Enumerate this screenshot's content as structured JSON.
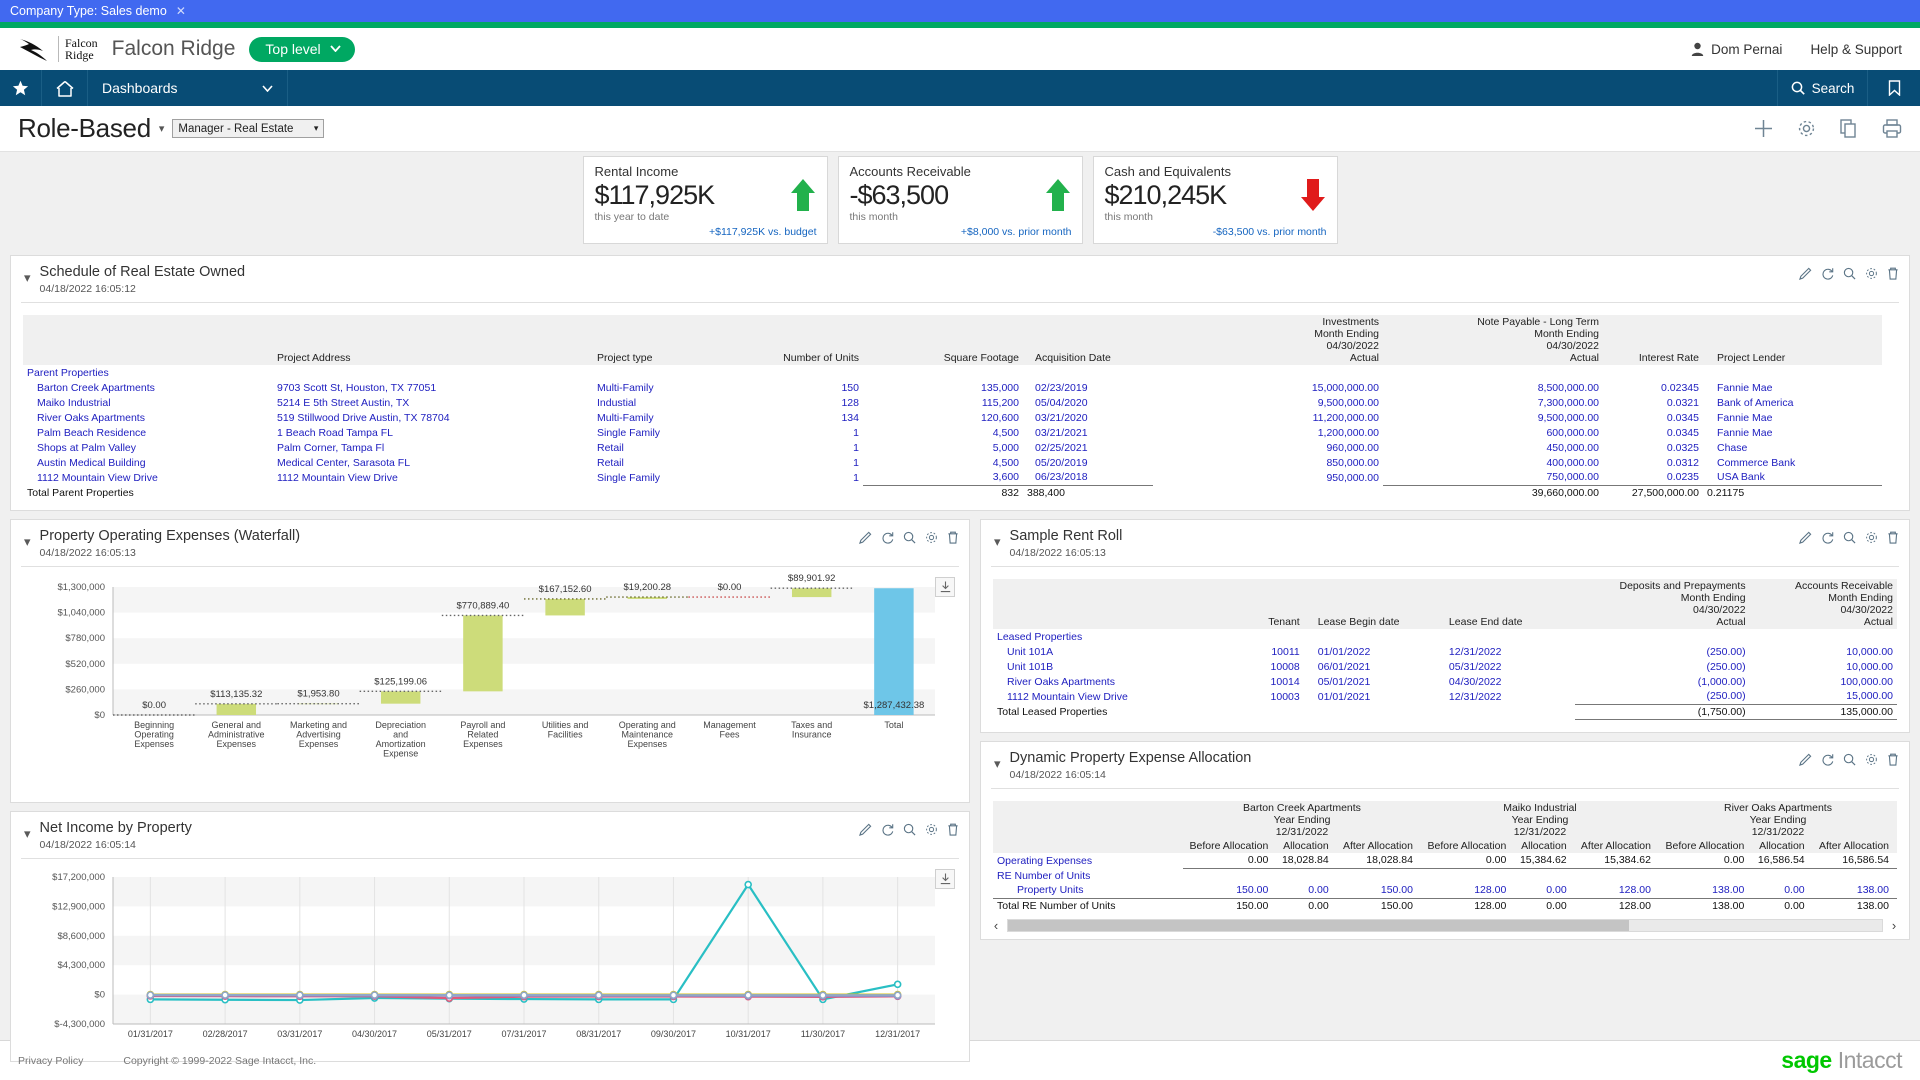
{
  "company_bar": {
    "label": "Company Type: Sales demo",
    "close": "✕"
  },
  "brand": {
    "logo_line1": "Falcon",
    "logo_line2": "Ridge",
    "name": "Falcon Ridge",
    "entity_pill": "Top level",
    "user": "Dom Pernai",
    "help": "Help & Support"
  },
  "nav": {
    "star_icon": "star-icon",
    "home_icon": "home-icon",
    "dashboards": "Dashboards",
    "search": "Search",
    "bookmark_icon": "bookmark-icon"
  },
  "page": {
    "title": "Role-Based",
    "role_select": "Manager - Real Estate",
    "icons": [
      "add-icon",
      "gear-icon",
      "copy-icon",
      "print-icon"
    ]
  },
  "kpis": [
    {
      "title": "Rental Income",
      "value": "$117,925K",
      "period": "this year to date",
      "delta": "+$117,925K vs. budget",
      "direction": "up",
      "color": "#22b14c"
    },
    {
      "title": "Accounts Receivable",
      "value": "-$63,500",
      "period": "this month",
      "delta": "+$8,000 vs. prior month",
      "direction": "up",
      "color": "#22b14c"
    },
    {
      "title": "Cash and Equivalents",
      "value": "$210,245K",
      "period": "this month",
      "delta": "-$63,500 vs. prior month",
      "direction": "down",
      "color": "#e01b1b"
    }
  ],
  "panel_icons": [
    "edit-icon",
    "refresh-icon",
    "search-icon",
    "gear-icon",
    "trash-icon"
  ],
  "schedule": {
    "title": "Schedule of Real Estate Owned",
    "date": "04/18/2022 16:05:12",
    "headers": {
      "name": "",
      "address": "Project Address",
      "type": "Project type",
      "units": "Number of Units",
      "sqft": "Square Footage",
      "acq": "Acquisition Date",
      "investments": [
        "Investments",
        "Month Ending",
        "04/30/2022",
        "Actual"
      ],
      "note_payable": [
        "Note Payable - Long Term",
        "Month Ending",
        "04/30/2022",
        "Actual"
      ],
      "rate": "Interest Rate",
      "lender": "Project Lender"
    },
    "group_label": "Parent Properties",
    "rows": [
      [
        "Barton Creek Apartments",
        "9703 Scott St, Houston, TX 77051",
        "Multi-Family",
        "150",
        "135,000",
        "02/23/2019",
        "15,000,000.00",
        "8,500,000.00",
        "0.02345",
        "Fannie Mae"
      ],
      [
        "Maiko Industrial",
        "5214 E 5th Street Austin, TX",
        "Industial",
        "128",
        "115,200",
        "05/04/2020",
        "9,500,000.00",
        "7,300,000.00",
        "0.0321",
        "Bank of America"
      ],
      [
        "River Oaks Apartments",
        "519 Stillwood Drive Austin, TX 78704",
        "Multi-Family",
        "134",
        "120,600",
        "03/21/2020",
        "11,200,000.00",
        "9,500,000.00",
        "0.0345",
        "Fannie Mae"
      ],
      [
        "Palm Beach Residence",
        "1 Beach Road Tampa FL",
        "Single Family",
        "1",
        "4,500",
        "03/21/2021",
        "1,200,000.00",
        "600,000.00",
        "0.0345",
        "Fannie Mae"
      ],
      [
        "Shops at Palm Valley",
        "Palm Corner, Tampa Fl",
        "Retail",
        "1",
        "5,000",
        "02/25/2021",
        "960,000.00",
        "450,000.00",
        "0.0325",
        "Chase"
      ],
      [
        "Austin Medical Building",
        "Medical Center, Sarasota FL",
        "Retail",
        "1",
        "4,500",
        "05/20/2019",
        "850,000.00",
        "400,000.00",
        "0.0312",
        "Commerce Bank"
      ],
      [
        "1112 Mountain View Drive",
        "1112 Mountain View Drive",
        "Single Family",
        "1",
        "3,600",
        "06/23/2018",
        "950,000.00",
        "750,000.00",
        "0.0235",
        "USA Bank"
      ]
    ],
    "total_label": "Total Parent Properties",
    "total": [
      "",
      "",
      "",
      "832",
      "388,400",
      "",
      "39,660,000.00",
      "27,500,000.00",
      "0.21175",
      ""
    ]
  },
  "waterfall": {
    "title": "Property Operating Expenses (Waterfall)",
    "date": "04/18/2022 16:05:13"
  },
  "netincome": {
    "title": "Net Income by Property",
    "date": "04/18/2022 16:05:14"
  },
  "rentroll": {
    "title": "Sample Rent Roll",
    "date": "04/18/2022 16:05:13",
    "headers": {
      "name": "",
      "tenant": "Tenant",
      "begin": "Lease Begin date",
      "end": "Lease End date",
      "deposits": [
        "Deposits and Prepayments",
        "Month Ending",
        "04/30/2022",
        "Actual"
      ],
      "ar": [
        "Accounts Receivable",
        "Month Ending",
        "04/30/2022",
        "Actual"
      ]
    },
    "group_label": "Leased Properties",
    "rows": [
      [
        "Unit 101A",
        "10011",
        "01/01/2022",
        "12/31/2022",
        "(250.00)",
        "10,000.00"
      ],
      [
        "Unit 101B",
        "10008",
        "06/01/2021",
        "05/31/2022",
        "(250.00)",
        "10,000.00"
      ],
      [
        "River Oaks Apartments",
        "10014",
        "05/01/2021",
        "04/30/2022",
        "(1,000.00)",
        "100,000.00"
      ],
      [
        "1112 Mountain View Drive",
        "10003",
        "01/01/2021",
        "12/31/2022",
        "(250.00)",
        "15,000.00"
      ]
    ],
    "total_label": "Total Leased Properties",
    "total": [
      "",
      "",
      "",
      "(1,750.00)",
      "135,000.00"
    ]
  },
  "allocation": {
    "title": "Dynamic Property Expense Allocation",
    "date": "04/18/2022 16:05:14",
    "property_groups": [
      {
        "name": "Barton Creek Apartments",
        "period1": "Year Ending",
        "period2": "12/31/2022"
      },
      {
        "name": "Maiko Industrial",
        "period1": "Year Ending",
        "period2": "12/31/2022"
      },
      {
        "name": "River Oaks Apartments",
        "period1": "Year Ending",
        "period2": "12/31/2022"
      }
    ],
    "sub_headers": [
      "Before Allocation",
      "Allocation",
      "After Allocation"
    ],
    "rows": [
      {
        "label": "Operating Expenses",
        "style": "link",
        "indent": 0,
        "values": [
          "0.00",
          "18,028.84",
          "18,028.84",
          "0.00",
          "15,384.62",
          "15,384.62",
          "0.00",
          "16,586.54",
          "16,586.54"
        ],
        "rule_below": true,
        "black": true
      },
      {
        "label": "RE Number of Units",
        "style": "link",
        "indent": 0,
        "values": [
          "",
          "",
          "",
          "",
          "",
          "",
          "",
          "",
          ""
        ]
      },
      {
        "label": "Property Units",
        "style": "link",
        "indent": 1,
        "values": [
          "150.00",
          "0.00",
          "150.00",
          "128.00",
          "0.00",
          "128.00",
          "138.00",
          "0.00",
          "138.00"
        ]
      },
      {
        "label": "Total RE Number of Units",
        "style": "plain",
        "indent": 0,
        "values": [
          "150.00",
          "0.00",
          "150.00",
          "128.00",
          "0.00",
          "128.00",
          "138.00",
          "0.00",
          "138.00"
        ],
        "rule_above": true,
        "black": true
      }
    ]
  },
  "footer": {
    "privacy": "Privacy Policy",
    "copyright": "Copyright © 1999-2022 Sage Intacct, Inc.",
    "logo_bold": "sage",
    "logo_light": "Intacct"
  },
  "chart_data": [
    {
      "type": "bar",
      "chart_style": "waterfall",
      "title": "Property Operating Expenses (Waterfall)",
      "xlabel": "",
      "ylabel": "",
      "ylim": [
        0,
        1300000
      ],
      "yticks": [
        "$0",
        "$260,000",
        "$520,000",
        "$780,000",
        "$1,040,000",
        "$1,300,000"
      ],
      "ytick_values": [
        0,
        260000,
        520000,
        780000,
        1040000,
        1300000
      ],
      "grid": true,
      "categories": [
        "Beginning Operating Expenses",
        "General and Administrative Expenses",
        "Marketing and Advertising Expenses",
        "Depreciation and Amortization Expense",
        "Payroll and Related Expenses",
        "Utilities and Facilities",
        "Operating and Maintenance Expenses",
        "Management Fees",
        "Taxes and Insurance",
        "Total"
      ],
      "labels": [
        "$0.00",
        "$113,135.32",
        "$1,953.80",
        "$125,199.06",
        "$770,889.40",
        "$167,152.60",
        "$19,200.28",
        "$0.00",
        "$89,901.92",
        "$1,287,432.38"
      ],
      "values": [
        0,
        113135.32,
        1953.8,
        125199.06,
        770889.4,
        167152.6,
        19200.28,
        0,
        89901.92,
        1287432.38
      ],
      "bases": [
        0,
        0,
        113135.32,
        115089.12,
        240288.18,
        1011177.58,
        1178330.18,
        1197530.46,
        1197530.46,
        0
      ],
      "bar_colors": [
        "#cddc7a",
        "#cddc7a",
        "#cddc7a",
        "#cddc7a",
        "#cddc7a",
        "#cddc7a",
        "#cddc7a",
        "#cddc7a",
        "#cddc7a",
        "#6ec6e8"
      ],
      "total_color": "#6ec6e8",
      "bar_color": "#cddc7a"
    },
    {
      "type": "line",
      "title": "Net Income by Property",
      "xlabel": "",
      "ylabel": "",
      "ylim": [
        -4300000,
        17200000
      ],
      "yticks": [
        "$-4,300,000",
        "$0",
        "$4,300,000",
        "$8,600,000",
        "$12,900,000",
        "$17,200,000"
      ],
      "ytick_values": [
        -4300000,
        0,
        4300000,
        8600000,
        12900000,
        17200000
      ],
      "grid": true,
      "x": [
        "01/31/2017",
        "02/28/2017",
        "03/31/2017",
        "04/30/2017",
        "05/31/2017",
        "07/31/2017",
        "08/31/2017",
        "09/30/2017",
        "10/31/2017",
        "11/30/2017",
        "12/31/2017"
      ],
      "series": [
        {
          "name": "series-1",
          "color": "#29bfc4",
          "values": [
            -700000,
            -750000,
            -800000,
            -500000,
            -600000,
            -650000,
            -700000,
            -700000,
            16100000,
            -700000,
            1500000
          ]
        },
        {
          "name": "series-2",
          "color": "#d9c21b",
          "values": [
            0,
            0,
            0,
            0,
            0,
            0,
            0,
            0,
            0,
            0,
            0
          ]
        },
        {
          "name": "series-3",
          "color": "#e05a7a",
          "values": [
            -200000,
            -230000,
            -250000,
            -230000,
            -520000,
            -300000,
            -280000,
            -280000,
            -300000,
            -330000,
            -250000
          ]
        },
        {
          "name": "series-4",
          "color": "#9a7fc0",
          "values": [
            -120000,
            -140000,
            -150000,
            -150000,
            -160000,
            -170000,
            -180000,
            -180000,
            -190000,
            -200000,
            -190000
          ]
        },
        {
          "name": "series-5",
          "color": "#8fa8c8",
          "values": [
            -60000,
            -70000,
            -70000,
            -70000,
            -80000,
            -80000,
            -90000,
            -90000,
            -90000,
            -100000,
            -90000
          ]
        }
      ]
    }
  ]
}
